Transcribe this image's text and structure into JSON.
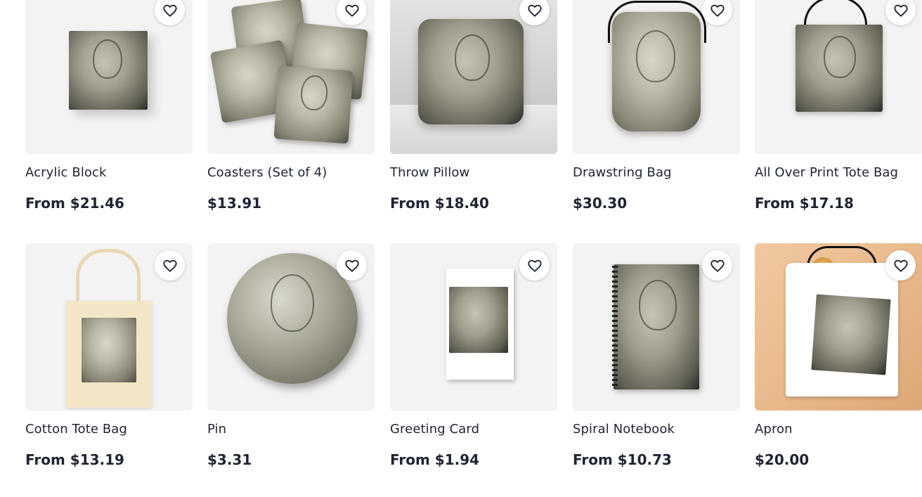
{
  "products_row1": [
    {
      "title": "Acrylic Block",
      "price": "From $21.46"
    },
    {
      "title": "Coasters (Set of 4)",
      "price": "$13.91"
    },
    {
      "title": "Throw Pillow",
      "price": "From $18.40"
    },
    {
      "title": "Drawstring Bag",
      "price": "$30.30"
    },
    {
      "title": "All Over Print Tote Bag",
      "price": "From $17.18"
    }
  ],
  "products_row2": [
    {
      "title": "Cotton Tote Bag",
      "price": "From $13.19"
    },
    {
      "title": "Pin",
      "price": "$3.31"
    },
    {
      "title": "Greeting Card",
      "price": "From $1.94"
    },
    {
      "title": "Spiral Notebook",
      "price": "From $10.73"
    },
    {
      "title": "Apron",
      "price": "$20.00"
    }
  ],
  "icons": {
    "favorite": "heart-outline-icon"
  },
  "colors": {
    "text": "#1f2433",
    "card_bg": "#f3f3f3",
    "fav_bg": "#ffffff"
  }
}
